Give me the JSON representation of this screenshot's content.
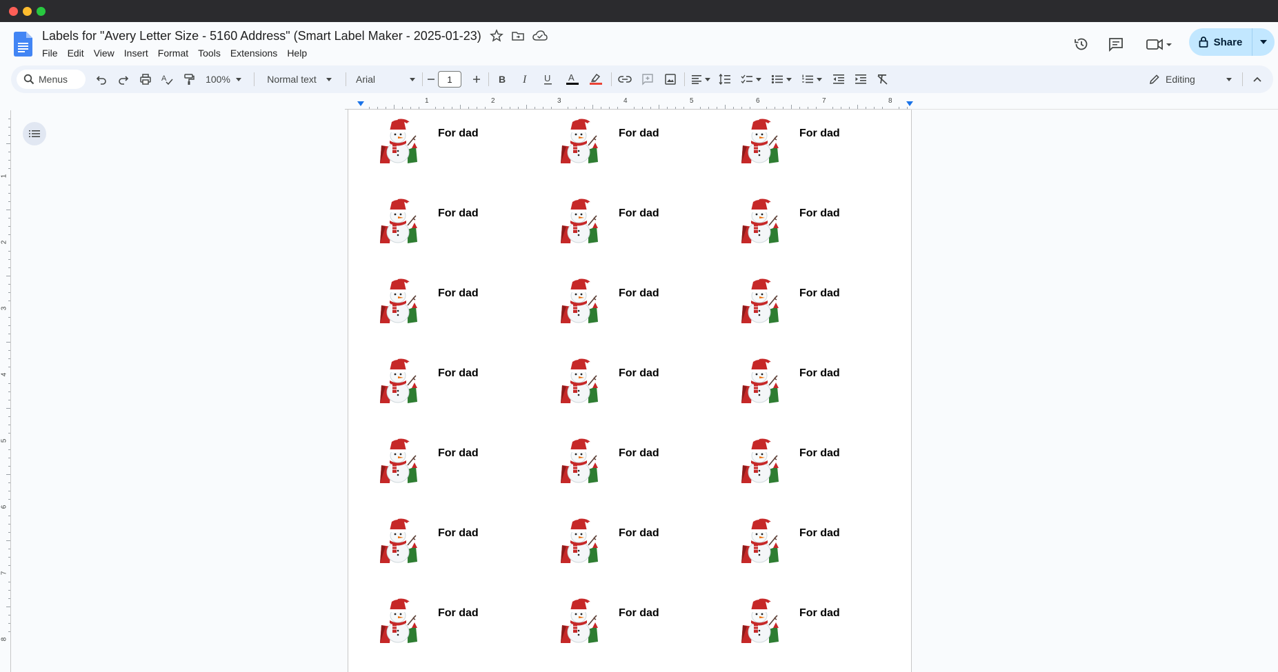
{
  "window": {
    "traffic_lights": [
      "close",
      "minimize",
      "zoom"
    ]
  },
  "header": {
    "title": "Labels for \"Avery Letter Size - 5160 Address\" (Smart Label Maker - 2025-01-23)",
    "menu": [
      "File",
      "Edit",
      "View",
      "Insert",
      "Format",
      "Tools",
      "Extensions",
      "Help"
    ],
    "share_label": "Share"
  },
  "toolbar": {
    "search_label": "Menus",
    "zoom": "100%",
    "style": "Normal text",
    "font": "Arial",
    "font_size": "1",
    "editing_mode": "Editing",
    "colors": {
      "text_color_bar": "#000000",
      "highlight_bar": "#ea4335"
    }
  },
  "ruler": {
    "numbers": [
      "1",
      "2",
      "3",
      "4",
      "5",
      "6",
      "7",
      "8"
    ]
  },
  "vruler": {
    "numbers": [
      "1",
      "2",
      "3",
      "4",
      "5",
      "6",
      "7",
      "8"
    ]
  },
  "document": {
    "labels": [
      "For dad",
      "For dad",
      "For dad",
      "For dad",
      "For dad",
      "For dad",
      "For dad",
      "For dad",
      "For dad",
      "For dad",
      "For dad",
      "For dad",
      "For dad",
      "For dad",
      "For dad",
      "For dad",
      "For dad",
      "For dad",
      "For dad",
      "For dad",
      "For dad"
    ],
    "label_image": "snowman-image"
  },
  "accent": {
    "docs_blue": "#4285f4",
    "share_bg": "#c2e7ff",
    "toolbar_bg": "#edf2fa"
  }
}
